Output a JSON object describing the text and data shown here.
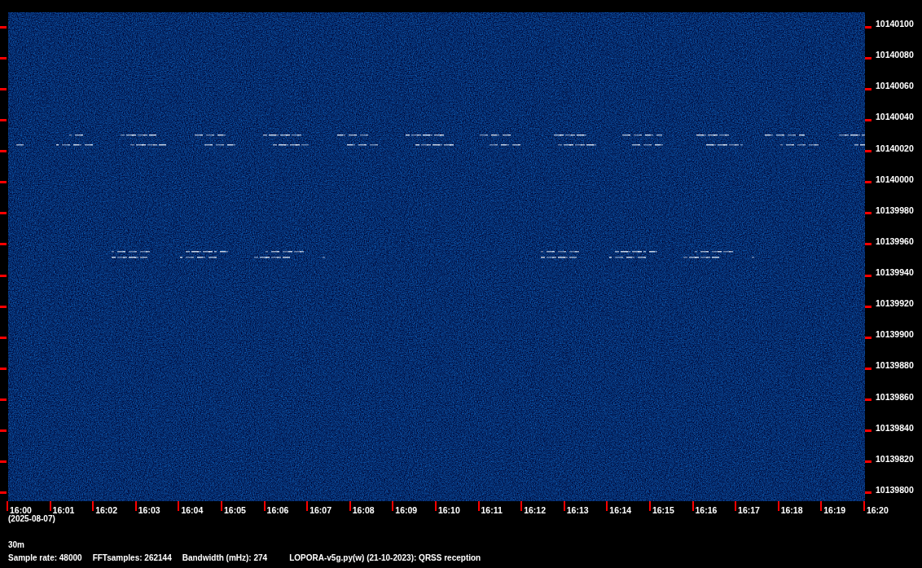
{
  "frequency_axis": {
    "labels": [
      "10140100",
      "10140080",
      "10140060",
      "10140040",
      "10140020",
      "10140000",
      "10139980",
      "10139960",
      "10139940",
      "10139920",
      "10139900",
      "10139880",
      "10139860",
      "10139840",
      "10139820",
      "10139800"
    ]
  },
  "time_axis": {
    "labels": [
      "16:00",
      "16:01",
      "16:02",
      "16:03",
      "16:04",
      "16:05",
      "16:06",
      "16:07",
      "16:08",
      "16:09",
      "16:10",
      "16:11",
      "16:12",
      "16:13",
      "16:14",
      "16:15",
      "16:16",
      "16:17",
      "16:18",
      "16:19",
      "16:20"
    ]
  },
  "date": "(2025-08-07)",
  "band": "30m",
  "info": [
    "Sample rate: 48000",
    "FFTsamples: 262144",
    "Bandwidth (mHz): 274",
    "LOPORA-v5g.py(w) (21-10-2023): QRSS reception"
  ]
}
